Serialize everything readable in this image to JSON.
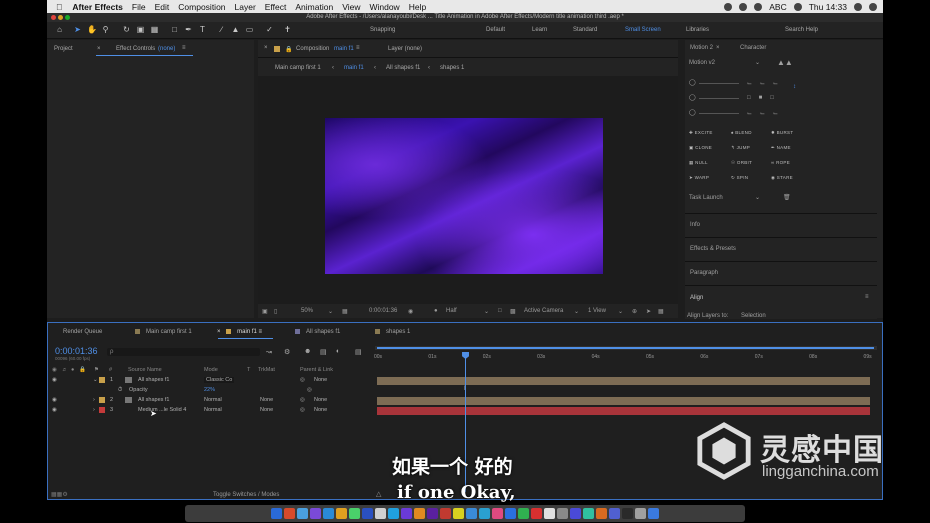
{
  "menubar": {
    "app_name": "After Effects",
    "items": [
      "File",
      "Edit",
      "Composition",
      "Layer",
      "Effect",
      "Animation",
      "View",
      "Window",
      "Help"
    ],
    "input_label": "ABC",
    "clock": "Thu 14:33"
  },
  "window_title": "Adobe After Effects - /Users/alanayoubi/Desk ... Title Animation in Adobe After Effects/Modern title animation third .aep *",
  "toolbar": {
    "snapping": "Snapping",
    "workspaces": [
      "Default",
      "Learn",
      "Standard",
      "Small Screen"
    ],
    "active_workspace": "Small Screen",
    "libraries": "Libraries",
    "search_placeholder": "Search Help"
  },
  "left_panel": {
    "project_tab": "Project",
    "effect_controls_tab": "Effect Controls",
    "effect_controls_none": "(none)"
  },
  "composition_panel": {
    "comp_tab_prefix": "Composition",
    "comp_name": "main f1",
    "layer_tab": "Layer (none)",
    "breadcrumbs": [
      "Main camp first 1",
      "main f1",
      "All shapes f1",
      "shapes 1"
    ],
    "active_breadcrumb": "main f1"
  },
  "viewer_bar": {
    "zoom": "50%",
    "timecode": "0:00:01:36",
    "resolution": "Half",
    "camera": "Active Camera",
    "views": "1 View"
  },
  "right_panel": {
    "tabs": [
      "Motion 2",
      "Character"
    ],
    "preset": "Motion v2",
    "buttons": [
      "EXCITE",
      "BLEND",
      "BURST",
      "CLONE",
      "JUMP",
      "NAME",
      "NULL",
      "ORBIT",
      "ROPE",
      "WARP",
      "SPIN",
      "STARE"
    ],
    "task": "Task Launch",
    "sections": [
      "Info",
      "Effects & Presets",
      "Paragraph",
      "Align"
    ],
    "align_sub": "Align Layers to:",
    "align_target": "Selection"
  },
  "timeline": {
    "tabs": [
      "Render Queue",
      "Main camp first 1",
      "main f1",
      "All shapes f1",
      "shapes 1"
    ],
    "tab_colors": [
      "#8a7a52",
      "#c8a04a",
      "#6f6f9a",
      "#8a7a52"
    ],
    "active_tab": "main f1",
    "timecode": "0:00:01:36",
    "fps_note": "00096 (60.00 fps)",
    "search_placeholder": "ρ",
    "columns": {
      "num": "#",
      "source": "Source Name",
      "mode": "Mode",
      "t": "T",
      "trkmat": "TrkMat",
      "parent": "Parent & Link"
    },
    "layers": [
      {
        "num": "1",
        "name": "All shapes f1",
        "mode": "Classic Co",
        "trkmat": "",
        "parent": "None",
        "color": "#c8a04a"
      },
      {
        "num": "2",
        "name": "All shapes f1",
        "mode": "Normal",
        "trkmat": "None",
        "parent": "None",
        "color": "#c8a04a"
      },
      {
        "num": "3",
        "name": "Medium ...le Solid 4",
        "mode": "Normal",
        "trkmat": "None",
        "parent": "None",
        "color": "#c43a3a"
      }
    ],
    "opacity_label": "Opacity",
    "opacity_value": "22%",
    "ruler": [
      "00s",
      "01s",
      "02s",
      "03s",
      "04s",
      "05s",
      "06s",
      "07s",
      "08s",
      "09s"
    ],
    "playhead_seconds": 1.6,
    "toggle_label": "Toggle Switches / Modes"
  },
  "subtitles": {
    "chinese": "如果一个 好的",
    "english": "if one Okay,"
  },
  "watermark": {
    "chinese": "灵感中国",
    "url": "lingganchina.com"
  },
  "dock_colors": [
    "#2a6ad8",
    "#d84a2a",
    "#4aa0e0",
    "#7a4ad8",
    "#2a8ad8",
    "#e0a020",
    "#4ad06a",
    "#2a50c0",
    "#d0d0d0",
    "#20a0e0",
    "#6a3ad8",
    "#e08a20",
    "#5a20a0",
    "#c03a30",
    "#d8d020",
    "#3a8ad8",
    "#2aa0d0",
    "#e04a80",
    "#2a70e0",
    "#30b050",
    "#d83030",
    "#e0e0e0",
    "#8a8a8a",
    "#4a4ad8",
    "#30c0a0",
    "#d86a20",
    "#5060d0",
    "#2a2a2a",
    "#a0a0a0",
    "#3a7ae0"
  ]
}
